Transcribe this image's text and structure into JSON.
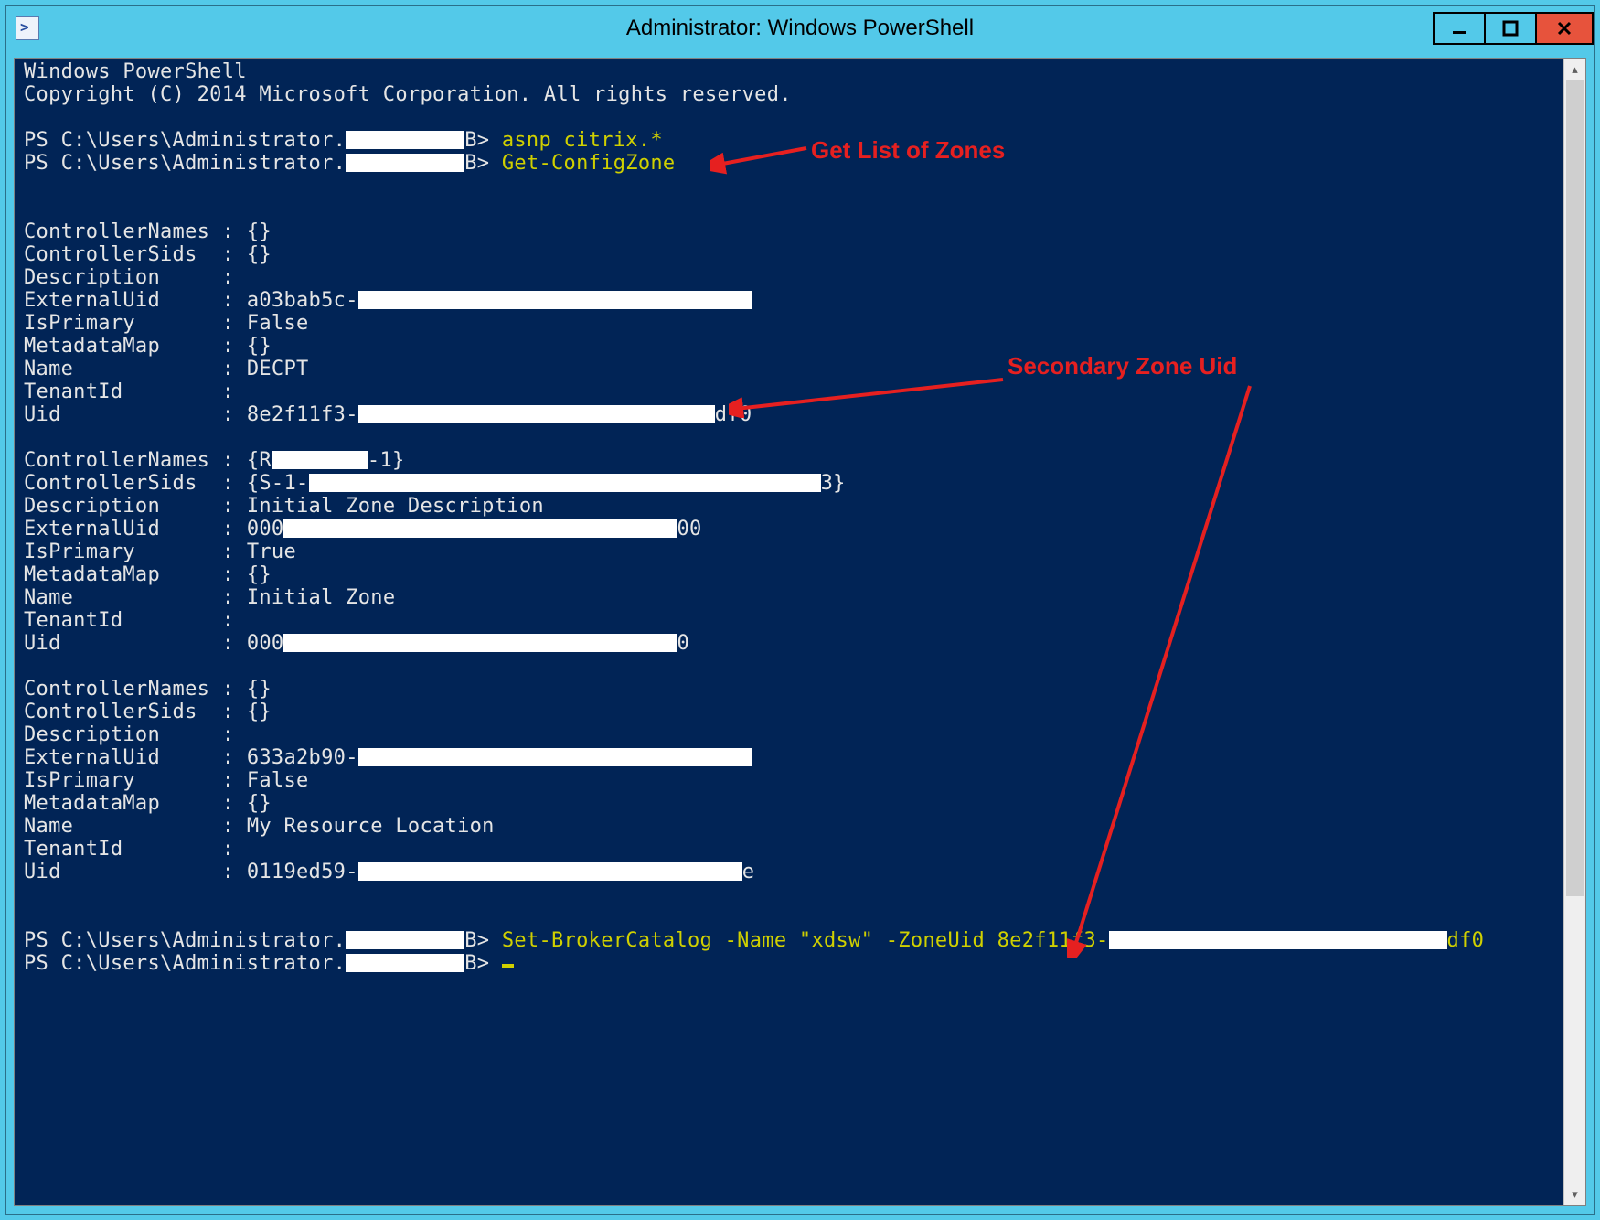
{
  "window": {
    "title": "Administrator: Windows PowerShell"
  },
  "annotations": {
    "get_zones": "Get List of Zones",
    "secondary_uid": "Secondary Zone Uid"
  },
  "ps": {
    "header1": "Windows PowerShell",
    "header2": "Copyright (C) 2014 Microsoft Corporation. All rights reserved.",
    "prompt_prefix": "PS C:\\Users\\Administrator.",
    "prompt_suffix": "B>",
    "cmd1": "asnp citrix.*",
    "cmd2": "Get-ConfigZone",
    "cmd3": "Set-BrokerCatalog -Name \"xdsw\" -ZoneUid 8e2f11f3-",
    "cmd3_tail": "df0",
    "zone1": {
      "ControllerNames": "{}",
      "ControllerSids": "{}",
      "Description": "",
      "ExternalUid_pre": "a03bab5c-",
      "IsPrimary": "False",
      "MetadataMap": "{}",
      "Name": "DECPT",
      "TenantId": "",
      "Uid_pre": "8e2f11f3-",
      "Uid_post": "df0"
    },
    "zone2": {
      "ControllerNames_pre": "{R",
      "ControllerNames_post": "-1}",
      "ControllerSids_pre": "{S-1-",
      "ControllerSids_post": "3}",
      "Description": "Initial Zone Description",
      "ExternalUid_pre": "000",
      "ExternalUid_post": "00",
      "IsPrimary": "True",
      "MetadataMap": "{}",
      "Name": "Initial Zone",
      "TenantId": "",
      "Uid_pre": "000",
      "Uid_post": "0"
    },
    "zone3": {
      "ControllerNames": "{}",
      "ControllerSids": "{}",
      "Description": "",
      "ExternalUid_pre": "633a2b90-",
      "ExternalUid_post": "",
      "IsPrimary": "False",
      "MetadataMap": "{}",
      "Name": "My Resource Location",
      "TenantId": "",
      "Uid_pre": "0119ed59-",
      "Uid_post": "e"
    },
    "labels": {
      "ControllerNames": "ControllerNames",
      "ControllerSids": "ControllerSids",
      "Description": "Description",
      "ExternalUid": "ExternalUid",
      "IsPrimary": "IsPrimary",
      "MetadataMap": "MetadataMap",
      "Name": "Name",
      "TenantId": "TenantId",
      "Uid": "Uid"
    }
  }
}
